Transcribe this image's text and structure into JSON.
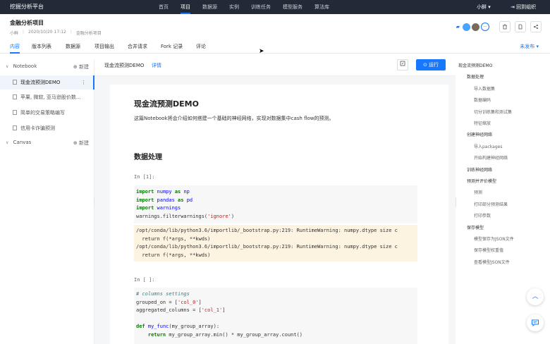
{
  "topnav": {
    "brand": "挖掘分析平台",
    "links": [
      "首页",
      "项目",
      "数据源",
      "实例",
      "训练任务",
      "模型服务",
      "算法库"
    ],
    "active_index": 1,
    "user": "小鲜 ▾",
    "org": "⇥ 回到组织"
  },
  "project": {
    "title": "金融分析项目",
    "owner": "小鲜",
    "date": "2020/10/20 17:12",
    "name": "金融分析项目"
  },
  "tabs": [
    "内容",
    "版本列表",
    "数据源",
    "项目输出",
    "合并请求",
    "Fork 记录",
    "评论"
  ],
  "active_tab": 0,
  "publish_label": "未发布 ▾",
  "sidebar": {
    "notebook_section": "Notebook",
    "canvas_section": "Canvas",
    "new_label": "⊕ 新建",
    "files": [
      "现金流预测DEMO",
      "苹果, 微软, 亚马逊股价数...",
      "简单的交易策略编写",
      "信用卡诈骗预测"
    ]
  },
  "toolbar": {
    "notebook_name": "现金流预测DEMO",
    "detail_label": "详情",
    "run_label": "⊙ 运行"
  },
  "doc": {
    "title": "现金流预测DEMO",
    "intro": "这篇Notebook将会介绍如何搭建一个基础的神经网络，实现对数据集中cash flow的预测。",
    "section_heading": "数据处理",
    "prompt1": "In [1]:",
    "prompt2": "In [ ]:",
    "out_lines": [
      "/opt/conda/lib/python3.6/importlib/_bootstrap.py:219: RuntimeWarning: numpy.dtype size c",
      "  return f(*args, **kwds)",
      "/opt/conda/lib/python3.6/importlib/_bootstrap.py:219: RuntimeWarning: numpy.dtype size c",
      "  return f(*args, **kwds)"
    ]
  },
  "outline": [
    {
      "label": "现金流预测DEMO",
      "level": 0
    },
    {
      "label": "数据处理",
      "level": 1
    },
    {
      "label": "导入数据集",
      "level": 2
    },
    {
      "label": "数据编码",
      "level": 2
    },
    {
      "label": "切分训练集和测试集",
      "level": 2
    },
    {
      "label": "特征缩放",
      "level": 2
    },
    {
      "label": "创建神经网络",
      "level": 1
    },
    {
      "label": "导入packages",
      "level": 2
    },
    {
      "label": "开始构建神经网络",
      "level": 2
    },
    {
      "label": "训练神经网络",
      "level": 1
    },
    {
      "label": "预测并评价模型",
      "level": 1
    },
    {
      "label": "预测",
      "level": 2
    },
    {
      "label": "打印部分预测结果",
      "level": 2
    },
    {
      "label": "打印参数",
      "level": 2
    },
    {
      "label": "保存模型",
      "level": 1
    },
    {
      "label": "模型保存为JSON文件",
      "level": 2
    },
    {
      "label": "保存模型权重值",
      "level": 2
    },
    {
      "label": "查看模型JSON文件",
      "level": 2
    }
  ],
  "colors": {
    "accent": "#1677ff",
    "topbar": "#222a37",
    "output_bg": "#fdf3e1"
  },
  "icons": [
    "trash-icon",
    "document-icon",
    "share-icon",
    "comment-icon",
    "chevron-up-icon",
    "save-icon"
  ]
}
